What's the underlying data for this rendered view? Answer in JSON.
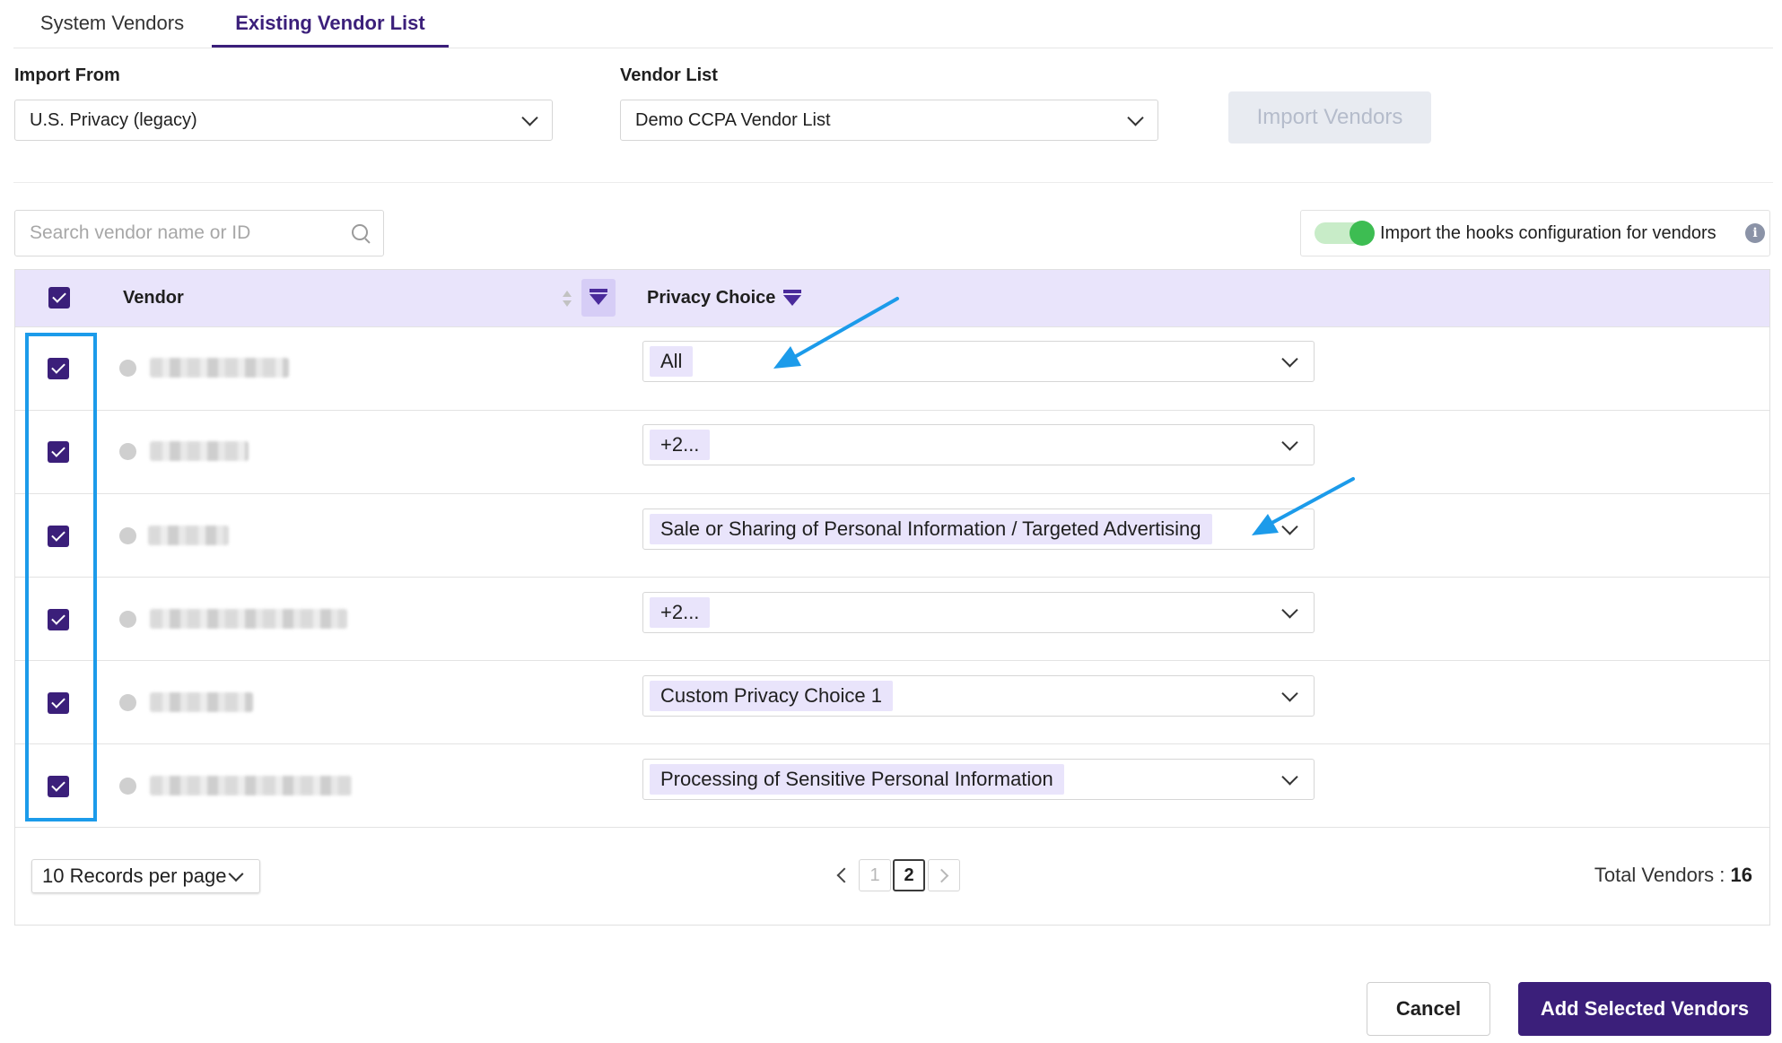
{
  "tabs": [
    {
      "label": "System Vendors",
      "active": false
    },
    {
      "label": "Existing Vendor List",
      "active": true
    }
  ],
  "import_from": {
    "label": "Import From",
    "value": "U.S. Privacy (legacy)"
  },
  "vendor_list": {
    "label": "Vendor List",
    "value": "Demo CCPA Vendor List"
  },
  "import_button": {
    "label": "Import Vendors",
    "disabled": true
  },
  "search": {
    "placeholder": "Search vendor name or ID",
    "value": ""
  },
  "hooks_toggle": {
    "label": "Import the hooks configuration for vendors",
    "on": true,
    "info_icon": "info-icon"
  },
  "table": {
    "header": {
      "vendor": "Vendor",
      "privacy_choice": "Privacy Choice",
      "select_all_checked": true
    },
    "rows": [
      {
        "checked": true,
        "vendor_name_blurred": true,
        "privacy_choice": "All"
      },
      {
        "checked": true,
        "vendor_name_blurred": true,
        "privacy_choice": "+2..."
      },
      {
        "checked": true,
        "vendor_name_blurred": true,
        "privacy_choice": "Sale or Sharing of Personal Information / Targeted Advertising"
      },
      {
        "checked": true,
        "vendor_name_blurred": true,
        "privacy_choice": "+2..."
      },
      {
        "checked": true,
        "vendor_name_blurred": true,
        "privacy_choice": "Custom Privacy Choice 1"
      },
      {
        "checked": true,
        "vendor_name_blurred": true,
        "privacy_choice": "Processing of Sensitive Personal Information"
      }
    ]
  },
  "pagination": {
    "records_per_page": "10 Records per page",
    "pages": [
      "1",
      "2"
    ],
    "current_page": "2",
    "total_label": "Total Vendors :",
    "total_value": "16"
  },
  "footer": {
    "cancel_label": "Cancel",
    "add_label": "Add Selected Vendors"
  },
  "colors": {
    "accent": "#3b1f7a",
    "header_bg": "#e9e4fb",
    "annotation": "#1c9bea",
    "toggle_on": "#3dbd52"
  }
}
